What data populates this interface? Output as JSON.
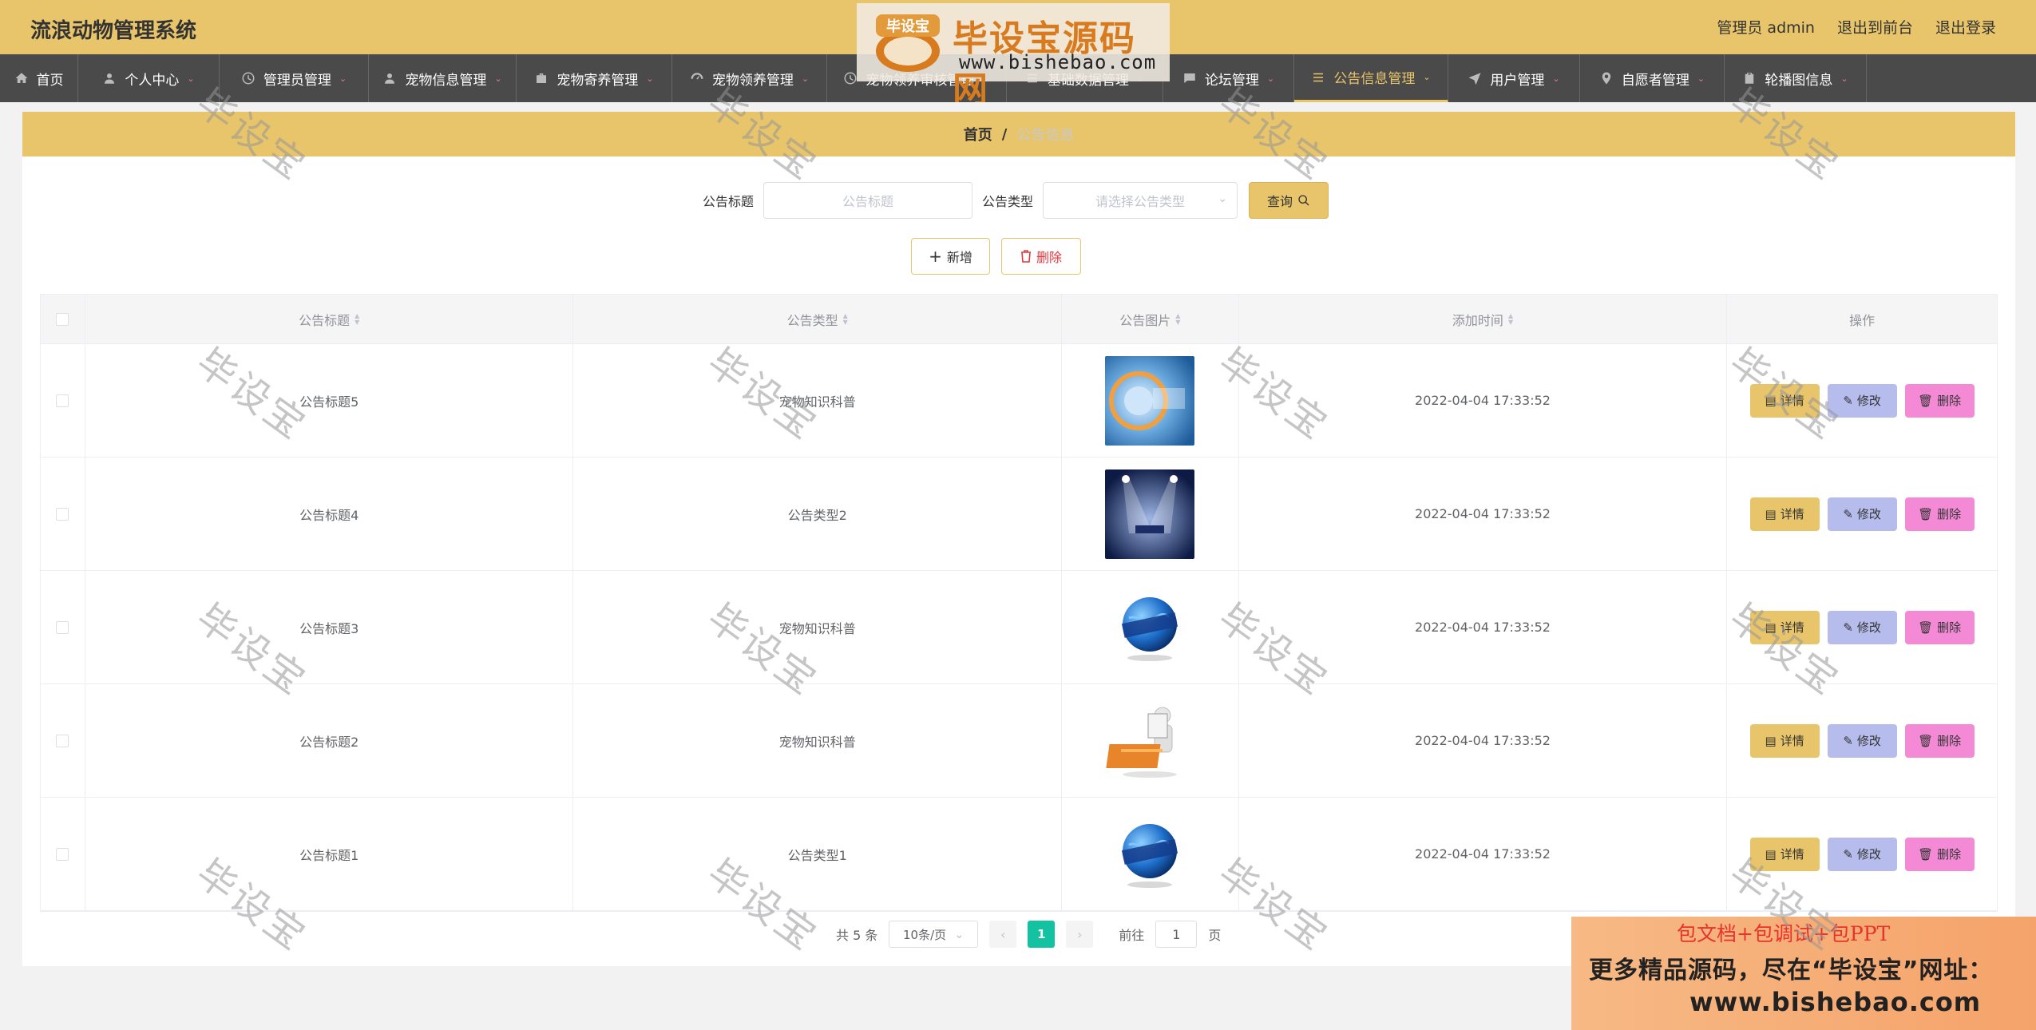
{
  "header": {
    "title": "流浪动物管理系统",
    "links": [
      "管理员 admin",
      "退出到前台",
      "退出登录"
    ]
  },
  "logo": {
    "brand": "毕设宝",
    "text": "毕设宝源码网",
    "url": "www.bishebao.com"
  },
  "nav": [
    {
      "label": "首页",
      "icon": "home-icon"
    },
    {
      "label": "个人中心",
      "icon": "user-icon"
    },
    {
      "label": "管理员管理",
      "icon": "clock-icon"
    },
    {
      "label": "宠物信息管理",
      "icon": "user-icon"
    },
    {
      "label": "宠物寄养管理",
      "icon": "briefcase-icon"
    },
    {
      "label": "宠物领养管理",
      "icon": "gauge-icon"
    },
    {
      "label": "宠物领养审核管理",
      "icon": "clock-icon"
    },
    {
      "label": "基础数据管理",
      "icon": "list-icon"
    },
    {
      "label": "论坛管理",
      "icon": "chat-icon"
    },
    {
      "label": "公告信息管理",
      "icon": "list-icon"
    },
    {
      "label": "用户管理",
      "icon": "send-icon"
    },
    {
      "label": "自愿者管理",
      "icon": "location-icon"
    },
    {
      "label": "轮播图信息",
      "icon": "clipboard-icon"
    }
  ],
  "breadcrumb": {
    "home": "首页",
    "sep": "/",
    "current": "公告信息"
  },
  "search": {
    "title_label": "公告标题",
    "title_placeholder": "公告标题",
    "type_label": "公告类型",
    "type_placeholder": "请选择公告类型",
    "query_label": "查询"
  },
  "actions": {
    "add_label": "新增",
    "delete_label": "删除"
  },
  "table": {
    "columns": [
      "公告标题",
      "公告类型",
      "公告图片",
      "添加时间",
      "操作"
    ],
    "rows": [
      {
        "title": "公告标题5",
        "type": "宠物知识科普",
        "time": "2022-04-04 17:33:52",
        "pic": "news-disc"
      },
      {
        "title": "公告标题4",
        "type": "公告类型2",
        "time": "2022-04-04 17:33:52",
        "pic": "news-stage"
      },
      {
        "title": "公告标题3",
        "type": "宠物知识科普",
        "time": "2022-04-04 17:33:52",
        "pic": "news-globe"
      },
      {
        "title": "公告标题2",
        "type": "宠物知识科普",
        "time": "2022-04-04 17:33:52",
        "pic": "news-figure"
      },
      {
        "title": "公告标题1",
        "type": "公告类型1",
        "time": "2022-04-04 17:33:52",
        "pic": "news-globe"
      }
    ],
    "ops": {
      "detail": "详情",
      "edit": "修改",
      "delete": "删除"
    }
  },
  "pagination": {
    "total": "共 5 条",
    "page_size": "10条/页",
    "current": "1",
    "goto_prefix": "前往",
    "goto_value": "1",
    "goto_suffix": "页"
  },
  "promo": {
    "line1": "包文档+包调试+包PPT",
    "line2": "更多精品源码，尽在“毕设宝”网址：",
    "line3": "www.bishebao.com"
  },
  "watermark": "毕设宝",
  "colors": {
    "accent": "#e8c56b",
    "nav_bg": "#4a4a4a",
    "edit": "#b6bcec",
    "delete": "#f48ad6",
    "page_active": "#13c2a0"
  }
}
